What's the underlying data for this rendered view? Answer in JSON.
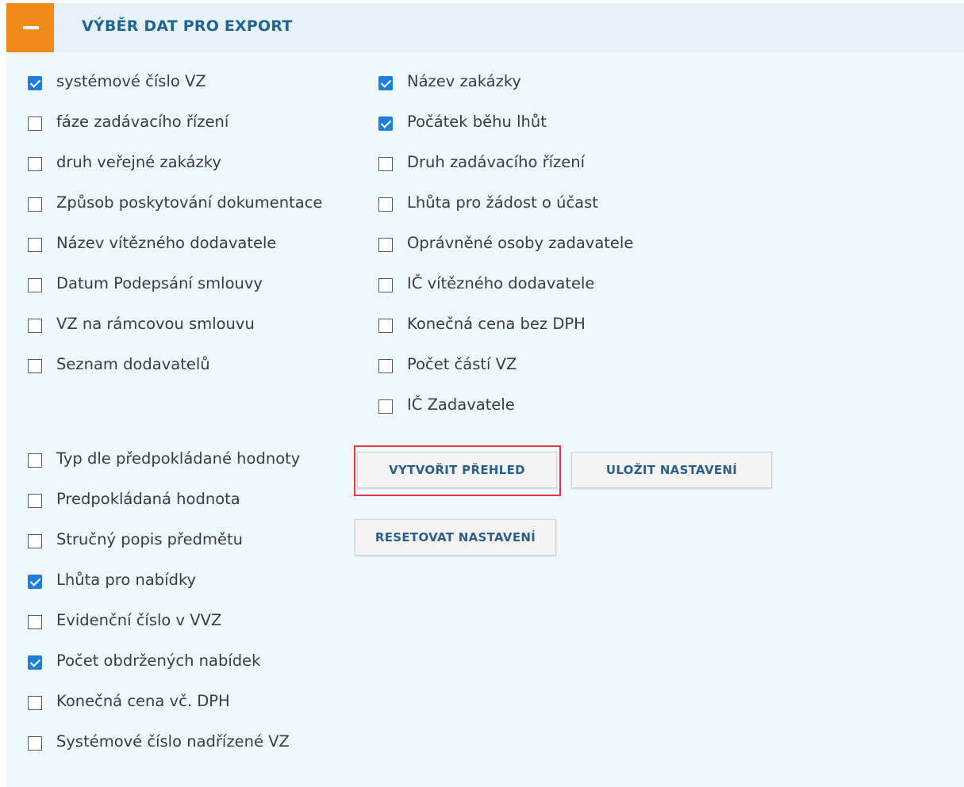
{
  "panel": {
    "title": "VÝBĚR DAT PRO EXPORT",
    "collapse_icon": "minus-icon",
    "accent_color": "#f08a1b",
    "title_color": "#1f6594",
    "check_color": "#1c7fe0",
    "highlight_color": "#e2373f"
  },
  "left_column": [
    {
      "label": "systémové číslo VZ",
      "checked": true
    },
    {
      "label": "fáze zadávacího řízení",
      "checked": false
    },
    {
      "label": "druh veřejné zakázky",
      "checked": false
    },
    {
      "label": "Způsob poskytování dokumentace",
      "checked": false
    },
    {
      "label": "Název vítězného dodavatele",
      "checked": false
    },
    {
      "label": "Datum Podepsání smlouvy",
      "checked": false
    },
    {
      "label": "VZ na rámcovou smlouvu",
      "checked": false
    },
    {
      "label": "Seznam dodavatelů",
      "checked": false
    }
  ],
  "right_column": [
    {
      "label": "Název zakázky",
      "checked": true
    },
    {
      "label": "Počátek běhu lhůt",
      "checked": true
    },
    {
      "label": "Druh zadávacího řízení",
      "checked": false
    },
    {
      "label": "Lhůta pro žádost o účast",
      "checked": false
    },
    {
      "label": "Oprávněné osoby zadavatele",
      "checked": false
    },
    {
      "label": "IČ vítězného dodavatele",
      "checked": false
    },
    {
      "label": "Konečná cena bez DPH",
      "checked": false
    },
    {
      "label": "Počet částí VZ",
      "checked": false
    },
    {
      "label": "IČ Zadavatele",
      "checked": false
    }
  ],
  "lower_column": [
    {
      "label": "Typ dle předpokládané hodnoty",
      "checked": false
    },
    {
      "label": "Predpokládaná hodnota",
      "checked": false
    },
    {
      "label": "Stručný popis předmětu",
      "checked": false
    },
    {
      "label": "Lhůta pro nabídky",
      "checked": true
    },
    {
      "label": "Evidenční číslo v VVZ",
      "checked": false
    },
    {
      "label": "Počet obdržených nabídek",
      "checked": true
    },
    {
      "label": "Konečná cena vč. DPH",
      "checked": false
    },
    {
      "label": "Systémové číslo nadřízené VZ",
      "checked": false
    }
  ],
  "buttons": {
    "create_overview": "VYTVOŘIT PŘEHLED",
    "save_settings": "ULOŽIT NASTAVENÍ",
    "reset_settings": "RESETOVAT NASTAVENÍ"
  }
}
